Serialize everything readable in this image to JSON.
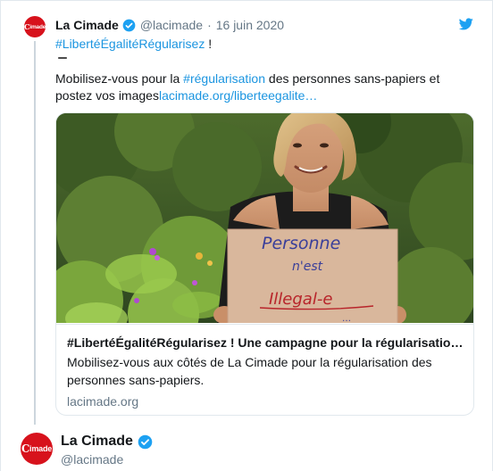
{
  "tweet": {
    "author": {
      "display_name": "La Cimade",
      "handle": "@lacimade",
      "verified": true,
      "avatar_text": "Cimade"
    },
    "separator": "·",
    "date": "16 juin 2020",
    "hashtag_line": "#LibertéÉgalitéRégularisez",
    "hashtag_line_suffix": " !",
    "emoji_fists": [
      "#4e3121",
      "#7d4e2f",
      "#b37a4c",
      "#e0b083",
      "#f3d2b3",
      "#ffcc3e"
    ],
    "body": {
      "prefix": "Mobilisez-vous pour la ",
      "hashtag": "#régularisation",
      "middle": " des personnes sans-papiers et",
      "line2_prefix": "postez vos images",
      "link": "lacimade.org/liberteegalite…"
    }
  },
  "card": {
    "image": {
      "sign_line1": "Personne",
      "sign_line2": "n'est",
      "sign_line3": "Illegal-e",
      "sign_line4": "…"
    },
    "title": "#LibertéÉgalitéRégularisez ! Une campagne pour la régularisation des personnes sans-papiers",
    "description": "Mobilisez-vous aux côtés de La Cimade pour la régularisation des personnes sans-papiers.",
    "domain": "lacimade.org"
  },
  "profile": {
    "display_name": "La Cimade",
    "handle": "@lacimade",
    "verified": true,
    "avatar_text": "Cimade"
  },
  "colors": {
    "link": "#1b95e0",
    "verified": "#1da1f2",
    "brand_red": "#d7121c",
    "muted": "#657786",
    "border": "#e1e8ed"
  },
  "icons": {
    "platform": "twitter-bird-icon",
    "verified": "verified-badge-icon"
  }
}
